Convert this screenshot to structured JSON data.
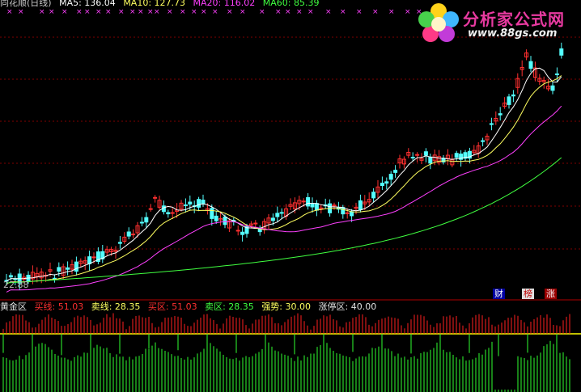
{
  "header": {
    "title": "同花顺(日线)",
    "ma5_label": "MA5: 136.04",
    "ma10_label": "MA10: 127.73",
    "ma20_label": "MA20: 116.02",
    "ma60_label": "MA60: 85.39"
  },
  "price_low_label": "22.88",
  "watermark": {
    "title": "分析家公式网",
    "url": "www.88gs.com"
  },
  "badges": {
    "cai": "财",
    "bang": "榜",
    "zhang": "涨"
  },
  "indicator": {
    "name": "黄金区",
    "buy_line": "买线: 51.03",
    "sell_line": "卖线: 28.35",
    "buy_zone": "买区: 51.03",
    "sell_zone": "卖区: 28.35",
    "strong": "强势: 30.00",
    "limit_zone": "涨停区: 40.00"
  },
  "colors": {
    "up": "#ff3030",
    "down": "#54ffff",
    "ma5": "#ffffff",
    "ma10": "#ffff60",
    "ma20": "#ff40ff",
    "ma60": "#40ff40",
    "grid": "#800000",
    "osc_red": "#ff2020",
    "osc_green": "#30ff30",
    "hline": "#ffff00"
  }
}
